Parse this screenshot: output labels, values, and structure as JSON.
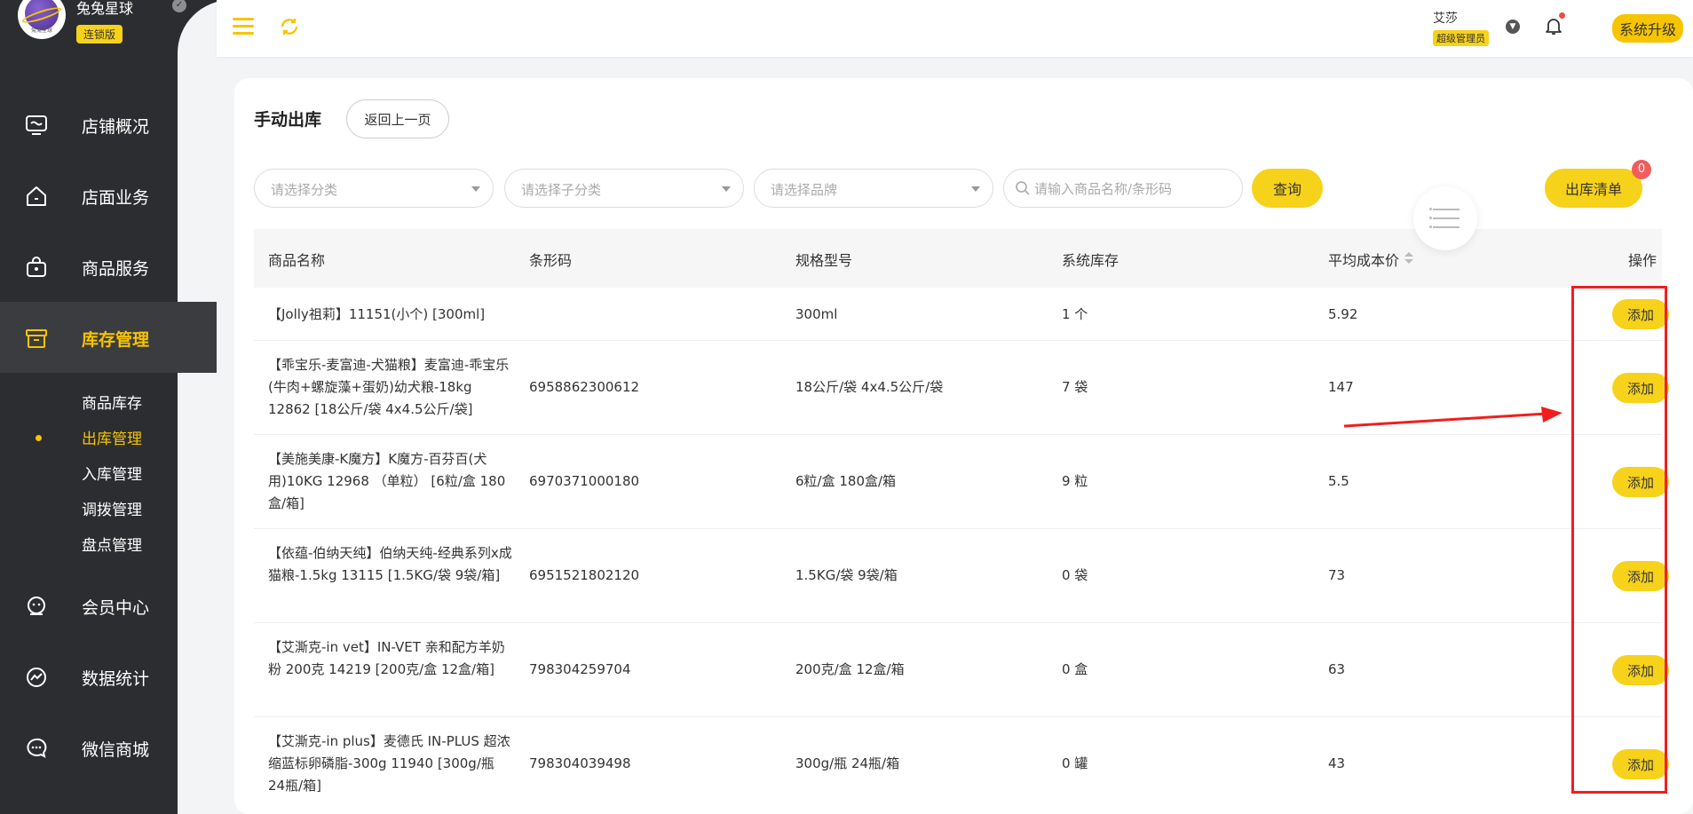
{
  "brand": {
    "name": "兔兔星球",
    "badge": "连锁版",
    "logo_text": "兔兔星球"
  },
  "sidebar": {
    "items": [
      {
        "label": "店铺概况",
        "icon": "monitor-icon"
      },
      {
        "label": "店面业务",
        "icon": "home-icon"
      },
      {
        "label": "商品服务",
        "icon": "bag-icon"
      },
      {
        "label": "库存管理",
        "icon": "inventory-icon",
        "active": true
      },
      {
        "label": "会员中心",
        "icon": "member-icon"
      },
      {
        "label": "数据统计",
        "icon": "chart-icon"
      },
      {
        "label": "微信商城",
        "icon": "wechat-icon"
      }
    ],
    "sub_items": [
      {
        "label": "商品库存"
      },
      {
        "label": "出库管理",
        "active": true
      },
      {
        "label": "入库管理"
      },
      {
        "label": "调拨管理"
      },
      {
        "label": "盘点管理"
      }
    ]
  },
  "header": {
    "user_name": "艾莎",
    "user_role": "超级管理员",
    "upgrade_label": "系统升级"
  },
  "page": {
    "title": "手动出库",
    "back_label": "返回上一页"
  },
  "filters": {
    "category_placeholder": "请选择分类",
    "subcategory_placeholder": "请选择子分类",
    "brand_placeholder": "请选择品牌",
    "search_placeholder": "请输入商品名称/条形码",
    "query_label": "查询",
    "list_label": "出库清单",
    "list_count": "0"
  },
  "table": {
    "headers": {
      "name": "商品名称",
      "barcode": "条形码",
      "spec": "规格型号",
      "stock": "系统库存",
      "cost": "平均成本价",
      "action": "操作"
    },
    "add_label": "添加",
    "rows": [
      {
        "name": "【Jolly祖莉】11151(小个) [300ml]",
        "barcode": "",
        "spec": "300ml",
        "stock": "1 个",
        "cost": "5.92"
      },
      {
        "name": "【乖宝乐-麦富迪-犬猫粮】麦富迪-乖宝乐(牛肉+螺旋藻+蛋奶)幼犬粮-18kg 12862 [18公斤/袋 4x4.5公斤/袋]",
        "barcode": "6958862300612",
        "spec": "18公斤/袋 4x4.5公斤/袋",
        "stock": "7 袋",
        "cost": "147"
      },
      {
        "name": "【美施美康-K魔方】K魔方-百芬百(犬用)10KG 12968 （单粒） [6粒/盒 180盒/箱]",
        "barcode": "6970371000180",
        "spec": "6粒/盒 180盒/箱",
        "stock": "9 粒",
        "cost": "5.5"
      },
      {
        "name": "【依蕴-伯纳天纯】伯纳天纯-经典系列x成猫粮-1.5kg 13115 [1.5KG/袋 9袋/箱]",
        "barcode": "6951521802120",
        "spec": "1.5KG/袋 9袋/箱",
        "stock": "0 袋",
        "cost": "73"
      },
      {
        "name": "【艾澌克-in vet】IN-VET 亲和配方羊奶粉 200克 14219 [200克/盒 12盒/箱]",
        "barcode": "798304259704",
        "spec": "200克/盒 12盒/箱",
        "stock": "0 盒",
        "cost": "63"
      },
      {
        "name": "【艾澌克-in plus】麦德氏 IN-PLUS 超浓缩蓝标卵磷脂-300g 11940 [300g/瓶 24瓶/箱]",
        "barcode": "798304039498",
        "spec": "300g/瓶 24瓶/箱",
        "stock": "0 罐",
        "cost": "43"
      }
    ]
  },
  "colors": {
    "accent": "#f7c400",
    "sidebar_bg": "#2c2d30",
    "annotation": "#f21e1e"
  }
}
